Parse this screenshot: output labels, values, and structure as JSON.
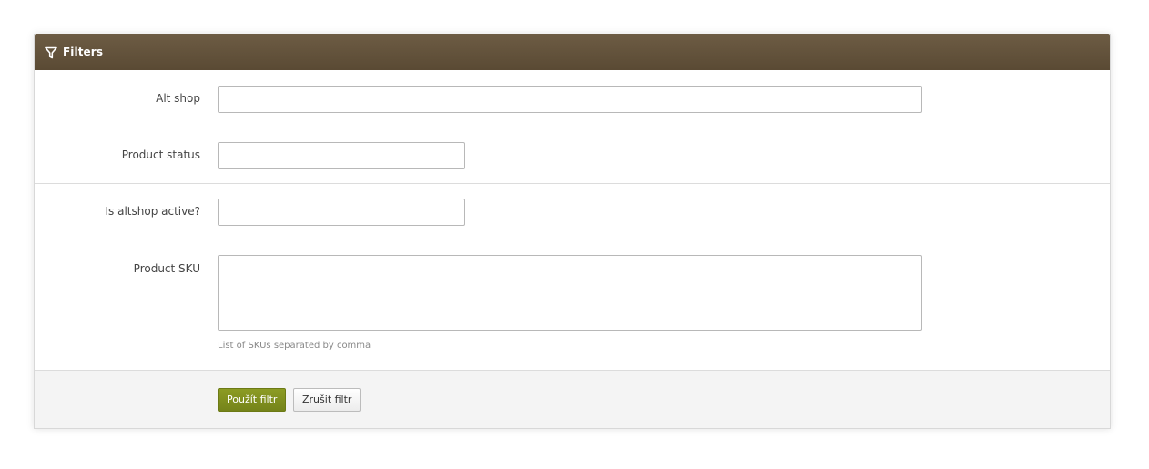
{
  "panel": {
    "title": "Filters",
    "icon": "filter-icon",
    "header_color": "#65543d"
  },
  "fields": {
    "alt_shop": {
      "label": "Alt shop",
      "value": ""
    },
    "product_status": {
      "label": "Product status",
      "value": ""
    },
    "altshop_active": {
      "label": "Is altshop active?",
      "value": ""
    },
    "product_sku": {
      "label": "Product SKU",
      "value": "",
      "help": "List of SKUs separated by comma"
    }
  },
  "actions": {
    "apply_label": "Použít filtr",
    "cancel_label": "Zrušit filtr",
    "apply_color": "#7f8e1e"
  }
}
